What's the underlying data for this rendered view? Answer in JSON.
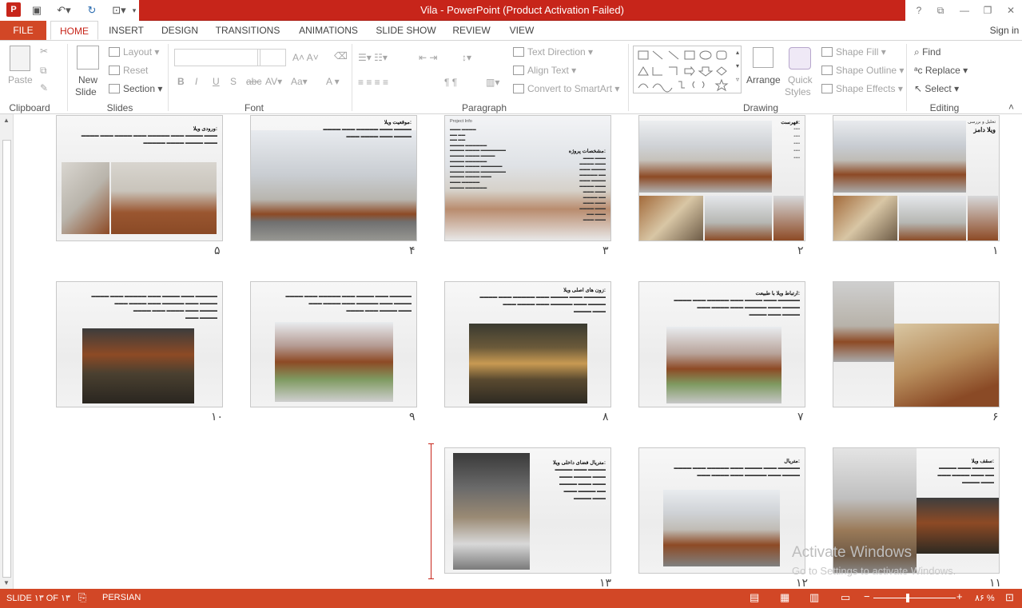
{
  "window": {
    "title": "Vila -  PowerPoint (Product Activation Failed)",
    "signin": "Sign in"
  },
  "tabs": [
    "FILE",
    "HOME",
    "INSERT",
    "DESIGN",
    "TRANSITIONS",
    "ANIMATIONS",
    "SLIDE SHOW",
    "REVIEW",
    "VIEW"
  ],
  "ribbon": {
    "clipboard": {
      "paste": "Paste",
      "label": "Clipboard"
    },
    "slides": {
      "new_slide": "New",
      "new_slide2": "Slide",
      "layout": "Layout",
      "reset": "Reset",
      "section": "Section",
      "label": "Slides"
    },
    "font": {
      "label": "Font"
    },
    "paragraph": {
      "text_direction": "Text Direction",
      "align_text": "Align Text",
      "smartart": "Convert to SmartArt",
      "label": "Paragraph"
    },
    "drawing": {
      "arrange": "Arrange",
      "quick_styles": "Quick",
      "quick_styles2": "Styles",
      "shape_fill": "Shape Fill",
      "shape_outline": "Shape Outline",
      "shape_effects": "Shape Effects",
      "label": "Drawing"
    },
    "editing": {
      "find": "Find",
      "replace": "Replace",
      "select": "Select",
      "label": "Editing"
    }
  },
  "slides": [
    {
      "num": "۱",
      "title": "ویلا دامز",
      "subtitle": "تحلیل و بررسی"
    },
    {
      "num": "۲",
      "title": "فهرست:"
    },
    {
      "num": "۳",
      "title": "مشخصات پروژه:",
      "header": "Project Info"
    },
    {
      "num": "۴",
      "title": "موقعیت ویلا:"
    },
    {
      "num": "۵",
      "title": "ورودی ویلا:"
    },
    {
      "num": "۶",
      "title": ""
    },
    {
      "num": "۷",
      "title": "ارتباط ویلا با طبیعت:"
    },
    {
      "num": "۸",
      "title": "زون های اصلی ویلا:"
    },
    {
      "num": "۹",
      "title": ""
    },
    {
      "num": "۱۰",
      "title": ""
    },
    {
      "num": "۱۱",
      "title": "سقف ویلا:"
    },
    {
      "num": "۱۲",
      "title": "متریال:"
    },
    {
      "num": "۱۳",
      "title": "متریال فضای داخلی ویلا:"
    }
  ],
  "watermark": {
    "line1": "Activate Windows",
    "line2": "Go to Settings to activate Windows."
  },
  "status": {
    "slide": "SLIDE ۱۳ OF ۱۳",
    "language": "PERSIAN",
    "zoom": "۸۶ %"
  },
  "colors": {
    "accent": "#c7251a",
    "status_bar": "#d24726"
  }
}
